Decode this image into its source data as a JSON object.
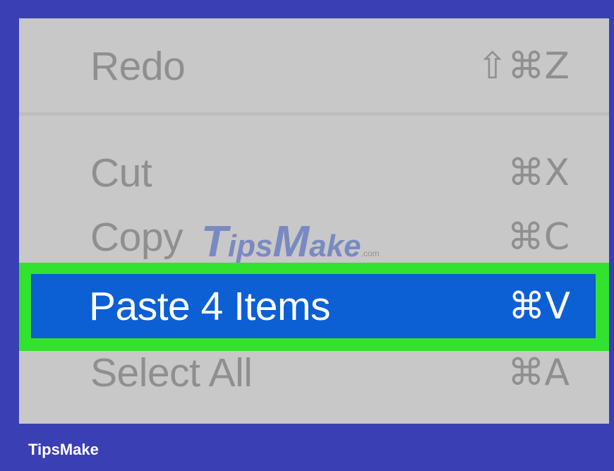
{
  "menu": {
    "items": [
      {
        "label": "Redo",
        "shortcut": "⇧⌘Z",
        "enabled": false
      },
      {
        "label": "Cut",
        "shortcut": "⌘X",
        "enabled": false
      },
      {
        "label": "Copy",
        "shortcut": "⌘C",
        "enabled": false
      },
      {
        "label": "Paste 4 Items",
        "shortcut": "⌘V",
        "enabled": true,
        "highlighted": true
      },
      {
        "label": "Select All",
        "shortcut": "⌘A",
        "enabled": false
      }
    ]
  },
  "watermark": {
    "part1": "T",
    "part2": "ips",
    "part3": "M",
    "part4": "ake",
    "part5": ".com"
  },
  "footer": {
    "brand": "TipsMake"
  },
  "colors": {
    "frame": "#3a3fb4",
    "menu_bg": "#c8c8c8",
    "disabled_text": "#8f8f8f",
    "highlight_bg": "#0d5fd4",
    "highlight_outline": "#33e22f",
    "highlight_text": "#ffffff"
  }
}
